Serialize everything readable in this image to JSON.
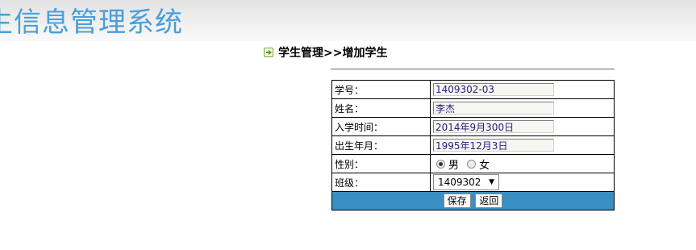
{
  "header": {
    "app_title": "生信息管理系统"
  },
  "breadcrumb": {
    "text": "学生管理>>增加学生"
  },
  "form": {
    "student_id": {
      "label": "学号：",
      "value": "1409302-03"
    },
    "name": {
      "label": "姓名：",
      "value": "李杰"
    },
    "enroll_date": {
      "label": "入学时间：",
      "value": "2014年9月300日"
    },
    "birth_date": {
      "label": "出生年月：",
      "value": "1995年12月3日"
    },
    "gender": {
      "label": "性别：",
      "options": [
        "男",
        "女"
      ],
      "selected": "男"
    },
    "class": {
      "label": "班级：",
      "selected": "1409302"
    },
    "save_label": "保存",
    "back_label": "返回"
  },
  "colors": {
    "title": "#4a9fd9",
    "action_bar": "#3a8fc2",
    "header_bg": "#e2e2e2"
  }
}
